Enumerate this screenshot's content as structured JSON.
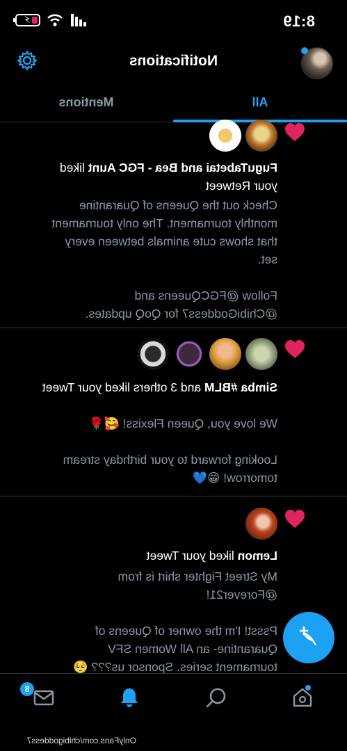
{
  "status_bar": {
    "time": "8:19"
  },
  "header": {
    "title": "Notifications"
  },
  "tabs": [
    {
      "label": "All"
    },
    {
      "label": "Mentions"
    }
  ],
  "notifications": [
    {
      "names": "FuguTabetai and Bea - FGC Aunt",
      "action": " liked your Retweet",
      "tweet": "Check out the Queens of Quarantine monthly tournament. The only tournament that shows cute animals between every set.\n\nFollow @FGCQueens and @ChibiGoddess7 for QoQ updates."
    },
    {
      "names": "Simba #BLM",
      "action": " and 3 others liked your Tweet",
      "tweet": "We love you, Queen Flexiss! 🥰🌹\n\nLooking forward to your birthday stream tomorrow! 😁💙"
    },
    {
      "names": "Lemon",
      "action": " liked your Tweet",
      "tweet": "My Street Fighter shirt is from @Forever21!\n\nPssst! I'm the owner of Queens of Quarantine- an All Women SFV tournament series. Sponsor us??? 🥺"
    }
  ],
  "bottom_nav": {
    "messages_badge": "8"
  },
  "watermark": "OnlyFans.com/chibigoddess7",
  "colors": {
    "accent": "#1da1f2",
    "heart": "#e0245e",
    "secondary_text": "#8899a6"
  }
}
